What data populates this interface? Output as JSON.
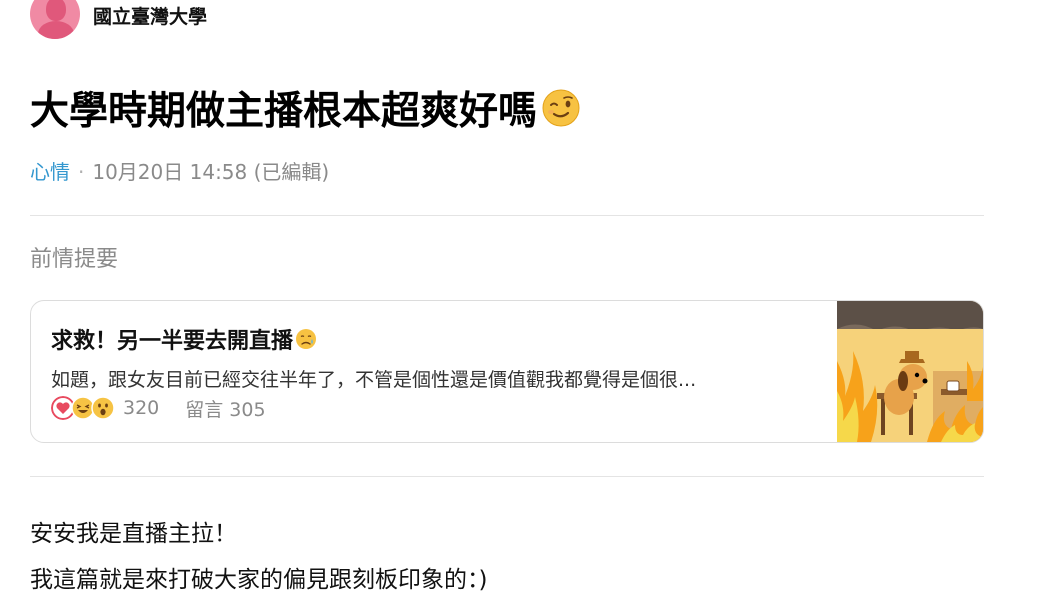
{
  "author": {
    "school": "國立臺灣大學",
    "avatar_icon": "female-avatar-icon"
  },
  "post": {
    "title": "大學時期做主播根本超爽好嗎",
    "title_emoji": "wink-emoji-icon",
    "forum": "心情",
    "separator": "·",
    "timestamp": "10月20日 14:58 (已編輯)"
  },
  "recap": {
    "label": "前情提要"
  },
  "linked_post": {
    "title": "求救！另一半要去開直播",
    "title_emoji": "sad-emoji-icon",
    "excerpt": "如題，跟女友目前已經交往半年了，不管是個性還是價值觀我都覺得是個很...",
    "reaction_icons": [
      "heart-icon",
      "laugh-emoji-icon",
      "wow-emoji-icon"
    ],
    "reaction_count": "320",
    "comments": "留言 305",
    "thumbnail_icon": "this-is-fine-dog-meme-image"
  },
  "body": {
    "line1": "安安我是直播主拉！",
    "line2": "我這篇就是來打破大家的偏見跟刻板印象的：)"
  },
  "colors": {
    "forum_link": "#3397cf",
    "meta_gray": "#8a8a8a",
    "avatar_pink": "#f08aa4",
    "divider": "#e4e4e4"
  }
}
